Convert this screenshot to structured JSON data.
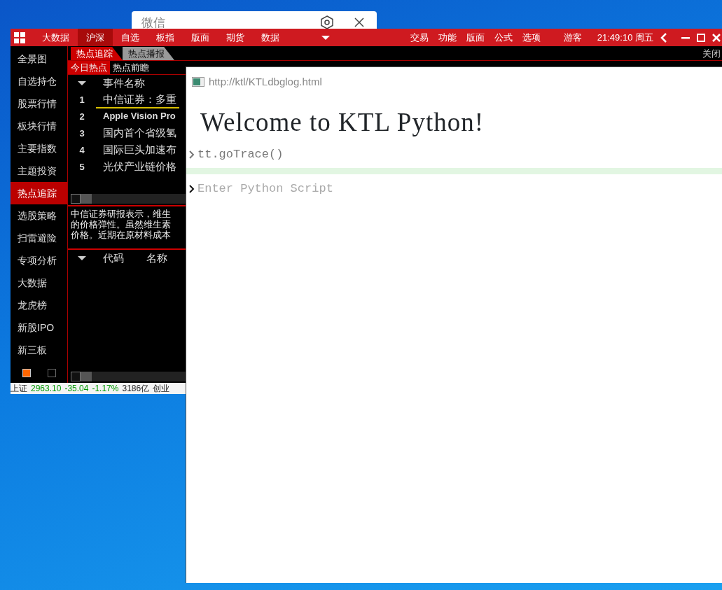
{
  "wechat": {
    "title": "微信"
  },
  "app": {
    "menu": [
      {
        "label": "大数据",
        "selected": false
      },
      {
        "label": "沪深",
        "selected": true
      },
      {
        "label": "自选",
        "selected": false
      },
      {
        "label": "板指",
        "selected": false
      },
      {
        "label": "版面",
        "selected": false
      },
      {
        "label": "期货",
        "selected": false
      },
      {
        "label": "数据",
        "selected": false
      }
    ],
    "menu_right": [
      "交易",
      "功能",
      "版面",
      "公式",
      "选项"
    ],
    "user": "游客",
    "clock": "21:49:10 周五",
    "sidebar": [
      {
        "label": "全景图",
        "selected": false
      },
      {
        "label": "自选持仓",
        "selected": false
      },
      {
        "label": "股票行情",
        "selected": false
      },
      {
        "label": "板块行情",
        "selected": false
      },
      {
        "label": "主要指数",
        "selected": false
      },
      {
        "label": "主题投资",
        "selected": false
      },
      {
        "label": "热点追踪",
        "selected": true
      },
      {
        "label": "选股策略",
        "selected": false
      },
      {
        "label": "扫雷避险",
        "selected": false
      },
      {
        "label": "专项分析",
        "selected": false
      },
      {
        "label": "大数据",
        "selected": false
      },
      {
        "label": "龙虎榜",
        "selected": false
      },
      {
        "label": "新股IPO",
        "selected": false
      },
      {
        "label": "新三板",
        "selected": false
      }
    ],
    "pager": [
      {
        "selected": true
      },
      {
        "selected": false
      }
    ],
    "tabs": [
      {
        "label": "热点追踪",
        "selected": true
      },
      {
        "label": "热点播报",
        "selected": false
      }
    ],
    "close": "关闭",
    "subtabs": [
      {
        "label": "今日热点",
        "selected": true
      },
      {
        "label": "热点前瞻",
        "selected": false
      }
    ],
    "events": {
      "columns": [
        "事件名称"
      ],
      "rows": [
        {
          "index": "1",
          "title": "中信证券：多重",
          "selected": true
        },
        {
          "index": "2",
          "title": "Apple Vision Pro",
          "selected": false
        },
        {
          "index": "3",
          "title": "国内首个省级氢",
          "selected": false
        },
        {
          "index": "4",
          "title": "国际巨头加速布",
          "selected": false
        },
        {
          "index": "5",
          "title": "光伏产业链价格",
          "selected": false
        }
      ]
    },
    "summary": [
      "中信证券研报表示，维生",
      "的价格弹性。虽然维生素",
      "价格。近期在原材料成本"
    ],
    "stocks": {
      "columns": [
        "代码",
        "名称"
      ]
    },
    "status_bar": [
      {
        "text": "上证",
        "kind": "label"
      },
      {
        "text": "2963.10",
        "kind": "down"
      },
      {
        "text": "-35.04",
        "kind": "down"
      },
      {
        "text": "-1.17%",
        "kind": "down"
      },
      {
        "text": "3186亿",
        "kind": "label"
      },
      {
        "text": "创业",
        "kind": "label"
      }
    ]
  },
  "console": {
    "url": "http://ktl/KTLdbglog.html",
    "heading": "Welcome to KTL Python!",
    "history": [
      "tt.goTrace()"
    ],
    "placeholder": "Enter Python Script"
  }
}
